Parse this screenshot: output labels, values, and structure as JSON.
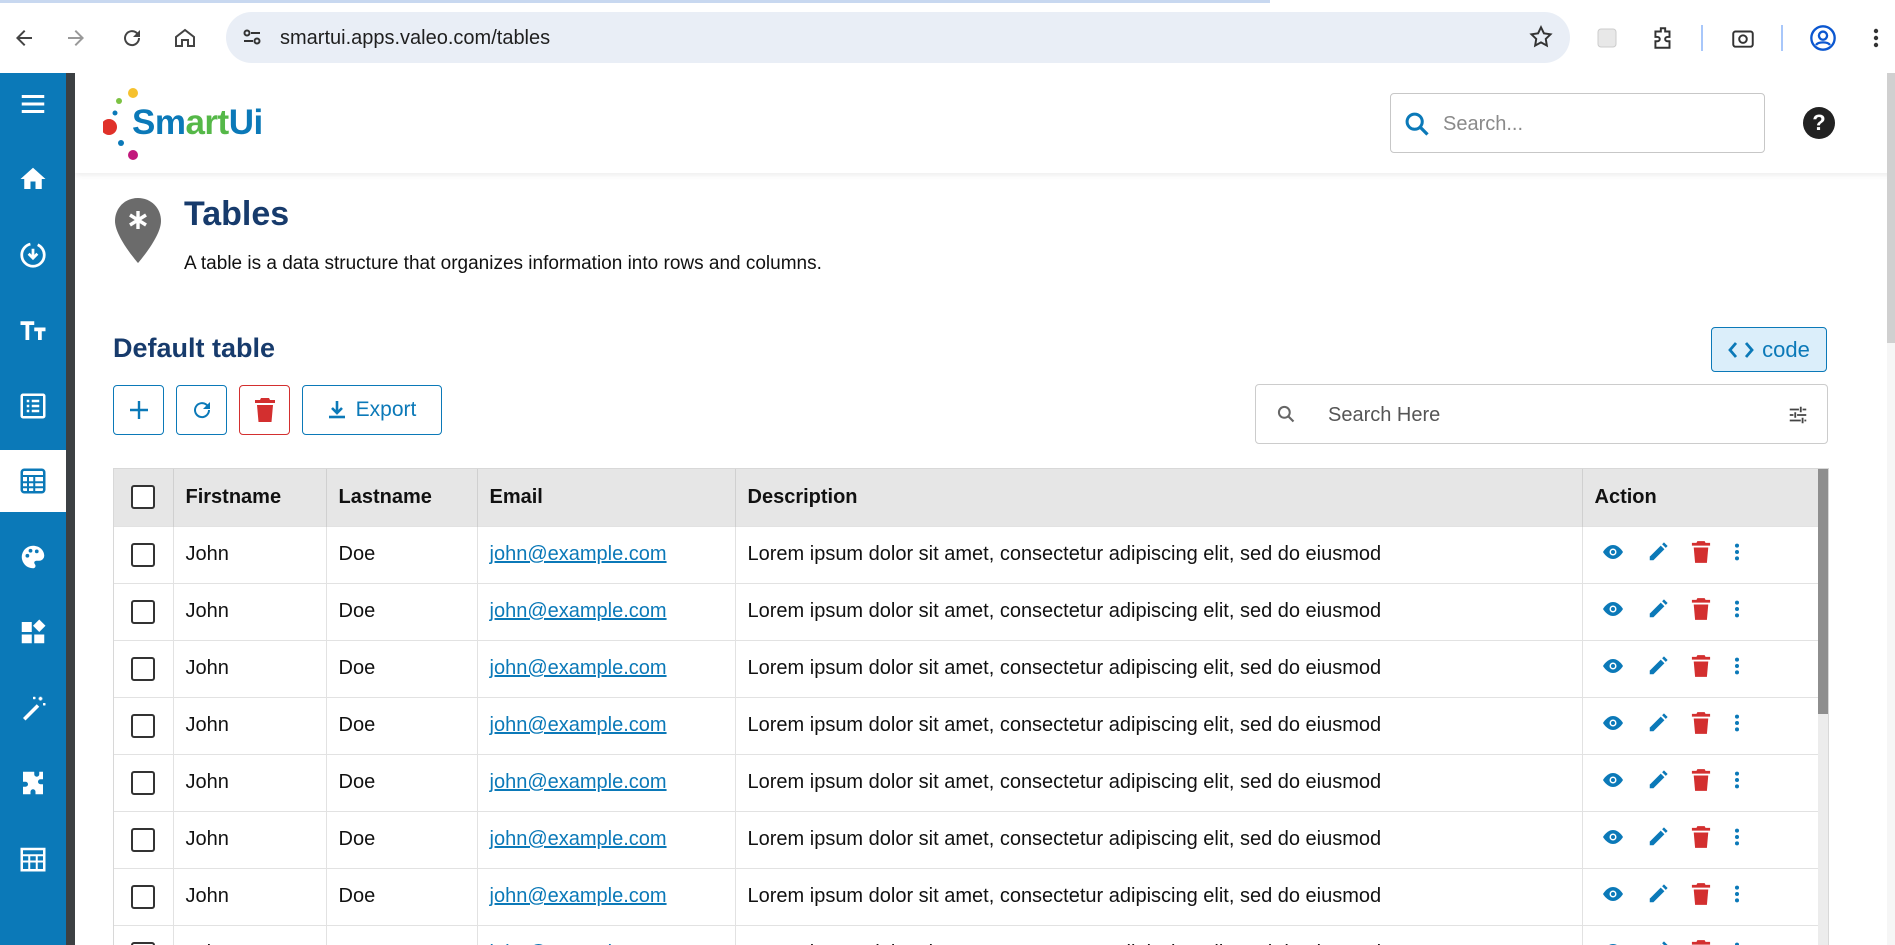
{
  "browser": {
    "url": "smartui.apps.valeo.com/tables",
    "icons": [
      "back-icon",
      "forward-icon",
      "reload-icon",
      "home-icon",
      "site-info-icon",
      "bookmark-star-icon",
      "extension-icon",
      "puzzle-icon",
      "screenshot-icon",
      "profile-icon",
      "menu-dots-icon"
    ]
  },
  "sidebar": {
    "items": [
      {
        "icon": "menu-icon"
      },
      {
        "icon": "home-icon"
      },
      {
        "icon": "download-circle-icon"
      },
      {
        "icon": "text-format-icon"
      },
      {
        "icon": "list-alt-icon"
      },
      {
        "icon": "table-calc-icon",
        "active": true
      },
      {
        "icon": "palette-icon"
      },
      {
        "icon": "widgets-icon"
      },
      {
        "icon": "magic-wand-icon"
      },
      {
        "icon": "puzzle-icon"
      },
      {
        "icon": "calendar-table-icon"
      }
    ],
    "color": "#0b79b8"
  },
  "header": {
    "logo": {
      "part1": "Sm",
      "part2": "art",
      "part3": "Ui"
    },
    "search_placeholder": "Search...",
    "help_label": "?"
  },
  "page": {
    "title": "Tables",
    "subtitle": "A table is a data structure that organizes information into rows and columns."
  },
  "section": {
    "title": "Default table",
    "code_label": "code",
    "export_label": "Export",
    "search_placeholder": "Search Here"
  },
  "table": {
    "columns": [
      "Firstname",
      "Lastname",
      "Email",
      "Description",
      "Action"
    ],
    "rows": [
      {
        "firstname": "John",
        "lastname": "Doe",
        "email": "john@example.com",
        "description": "Lorem ipsum dolor sit amet, consectetur adipiscing elit, sed do eiusmod"
      },
      {
        "firstname": "John",
        "lastname": "Doe",
        "email": "john@example.com",
        "description": "Lorem ipsum dolor sit amet, consectetur adipiscing elit, sed do eiusmod"
      },
      {
        "firstname": "John",
        "lastname": "Doe",
        "email": "john@example.com",
        "description": "Lorem ipsum dolor sit amet, consectetur adipiscing elit, sed do eiusmod"
      },
      {
        "firstname": "John",
        "lastname": "Doe",
        "email": "john@example.com",
        "description": "Lorem ipsum dolor sit amet, consectetur adipiscing elit, sed do eiusmod"
      },
      {
        "firstname": "John",
        "lastname": "Doe",
        "email": "john@example.com",
        "description": "Lorem ipsum dolor sit amet, consectetur adipiscing elit, sed do eiusmod"
      },
      {
        "firstname": "John",
        "lastname": "Doe",
        "email": "john@example.com",
        "description": "Lorem ipsum dolor sit amet, consectetur adipiscing elit, sed do eiusmod"
      },
      {
        "firstname": "John",
        "lastname": "Doe",
        "email": "john@example.com",
        "description": "Lorem ipsum dolor sit amet, consectetur adipiscing elit, sed do eiusmod"
      },
      {
        "firstname": "John",
        "lastname": "Doe",
        "email": "john@example.com",
        "description": "Lorem ipsum dolor sit amet, consectetur adipiscing elit, sed do eiusmod"
      }
    ],
    "action_icons": [
      "eye-icon",
      "pencil-icon",
      "trash-icon",
      "more-vert-icon"
    ],
    "colors": {
      "primary": "#0b79b8",
      "danger": "#d32f2f",
      "header_bg": "#e6e6e6"
    }
  }
}
